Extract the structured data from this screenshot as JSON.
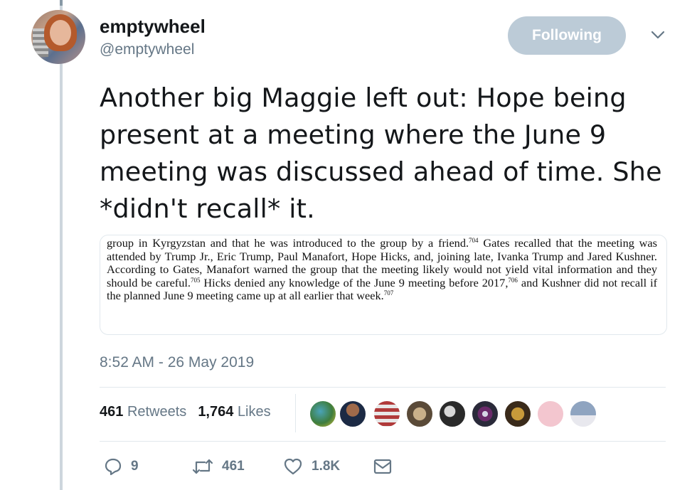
{
  "author": {
    "name": "emptywheel",
    "handle": "@emptywheel",
    "follow_label": "Following"
  },
  "tweet": {
    "text": "Another big Maggie left out: Hope being present at a meeting where the June 9 meeting was discussed ahead of time. She *didn't recall* it.",
    "timestamp": "8:52 AM - 26 May 2019"
  },
  "attached_document": {
    "segments": [
      "group in Kyrgyzstan and that he was introduced to the group by a friend.",
      "704",
      " Gates recalled that the meeting was attended by Trump Jr., Eric Trump, Paul Manafort, Hope Hicks, and, joining late, Ivanka Trump and Jared Kushner. According to Gates, Manafort warned the group that the meeting likely would not yield vital information and they should be careful.",
      "705",
      " Hicks denied any knowledge of the June 9 meeting before 2017,",
      "706",
      " and Kushner did not recall if the planned June 9 meeting came up at all earlier that week.",
      "707"
    ]
  },
  "stats": {
    "retweets_count": "461",
    "retweets_label": "Retweets",
    "likes_count": "1,764",
    "likes_label": "Likes"
  },
  "actions": {
    "reply_count": "9",
    "retweet_count": "461",
    "like_count": "1.8K"
  },
  "icons": {
    "reply": "reply-icon",
    "retweet": "retweet-icon",
    "like": "heart-icon",
    "message": "envelope-icon",
    "caret": "chevron-down-icon"
  },
  "colors": {
    "follow_button": "#bccbd7",
    "secondary_text": "#657786",
    "primary_text": "#14171a"
  }
}
